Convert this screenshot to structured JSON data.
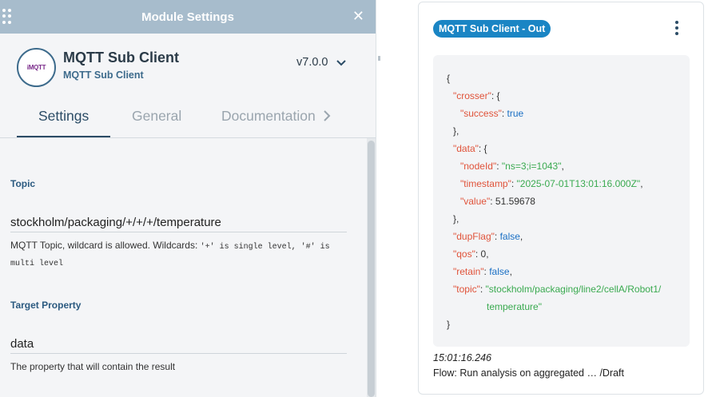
{
  "panel": {
    "title": "Module Settings",
    "close_icon": "✕"
  },
  "module": {
    "logo_text": "iMQTT",
    "name": "MQTT Sub Client",
    "subtitle": "MQTT Sub Client",
    "version": "v7.0.0"
  },
  "tabs": [
    {
      "label": "Settings",
      "active": true
    },
    {
      "label": "General",
      "active": false
    },
    {
      "label": "Documentation",
      "active": false
    }
  ],
  "fields": {
    "topic": {
      "label": "Topic",
      "value": "stockholm/packaging/+/+/+/temperature",
      "help_prefix": "MQTT Topic, wildcard is allowed. Wildcards: ",
      "help_code": "'+' is single level, '#' is multi level"
    },
    "target": {
      "label": "Target Property",
      "value": "data",
      "help": "The property that will contain the result"
    }
  },
  "card": {
    "badge": "MQTT Sub Client - Out",
    "json": {
      "l1": "{",
      "crosser_key": "\"crosser\"",
      "success_key": "\"success\"",
      "success_val": "true",
      "close_obj": "},",
      "data_key": "\"data\"",
      "nodeid_key": "\"nodeId\"",
      "nodeid_val": "\"ns=3;i=1043\"",
      "ts_key": "\"timestamp\"",
      "ts_val": "\"2025-07-01T13:01:16.000Z\"",
      "value_key": "\"value\"",
      "value_val": "51.59678",
      "dup_key": "\"dupFlag\"",
      "dup_val": "false",
      "qos_key": "\"qos\"",
      "qos_val": "0",
      "retain_key": "\"retain\"",
      "retain_val": "false",
      "topic_key": "\"topic\"",
      "topic_val_1": "\"stockholm/packaging/line2/cellA/Robot1/",
      "topic_val_2": "temperature\"",
      "end": "}"
    },
    "time": "15:01:16.246",
    "flow": "Flow: Run analysis on aggregated … /Draft"
  }
}
